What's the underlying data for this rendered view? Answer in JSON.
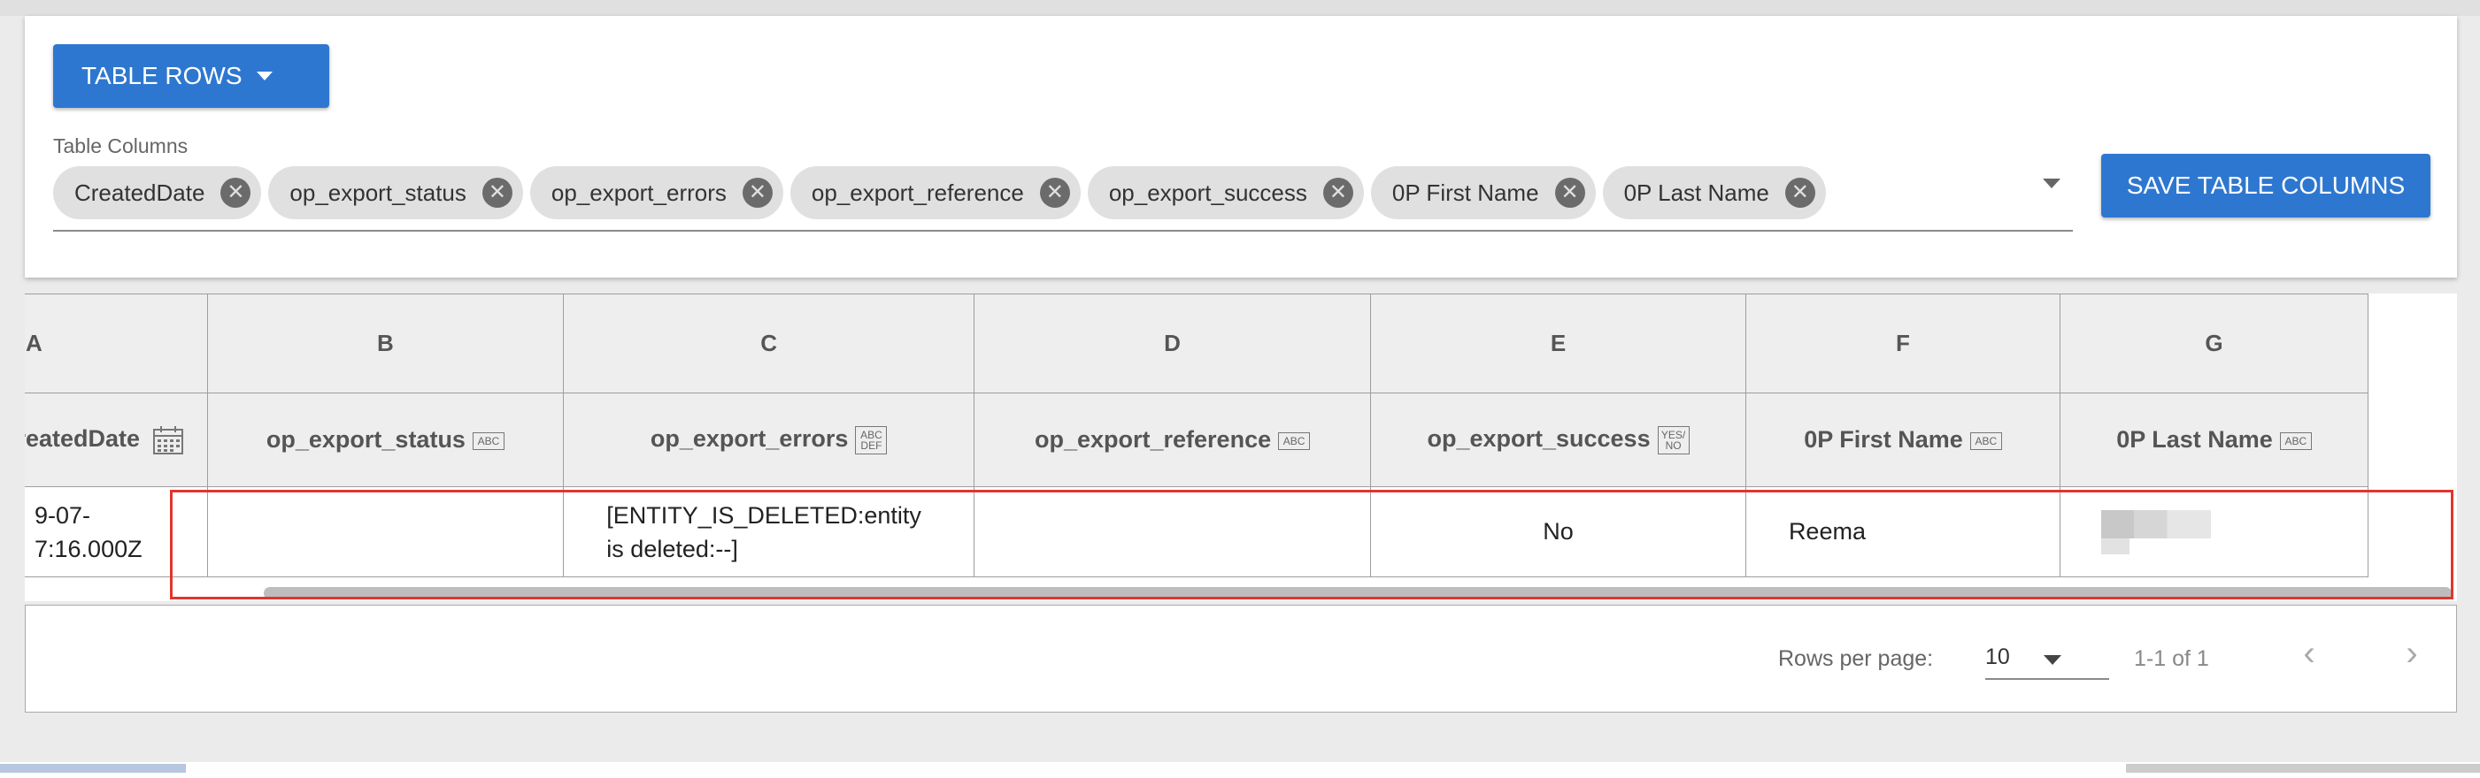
{
  "toolbar": {
    "table_rows_label": "TABLE ROWS",
    "save_columns_label": "SAVE TABLE COLUMNS"
  },
  "columns_field": {
    "label": "Table Columns",
    "chips": [
      "CreatedDate",
      "op_export_status",
      "op_export_errors",
      "op_export_reference",
      "op_export_success",
      "0P First Name",
      "0P Last Name"
    ]
  },
  "grid": {
    "letters": [
      "A",
      "B",
      "C",
      "D",
      "E",
      "F",
      "G"
    ],
    "headers": [
      {
        "name": "CreatedDate",
        "type": "date"
      },
      {
        "name": "op_export_status",
        "type": "ABC"
      },
      {
        "name": "op_export_errors",
        "type": "ABC DEF"
      },
      {
        "name": "op_export_reference",
        "type": "ABC"
      },
      {
        "name": "op_export_success",
        "type": "YES NO"
      },
      {
        "name": "0P First Name",
        "type": "ABC"
      },
      {
        "name": "0P Last Name",
        "type": "ABC"
      }
    ],
    "row": {
      "a_line1": "9-07-",
      "a_line2": "7:16.000Z",
      "b": "",
      "c_line1": "[ENTITY_IS_DELETED:entity",
      "c_line2": "is deleted:--]",
      "d": "",
      "e": "No",
      "f": "Reema",
      "g": ""
    }
  },
  "pagination": {
    "rows_per_page_label": "Rows per page:",
    "rows_per_page_value": "10",
    "range": "1-1 of 1"
  },
  "colors": {
    "primary": "#2e77d0",
    "highlight": "#e0362c"
  }
}
